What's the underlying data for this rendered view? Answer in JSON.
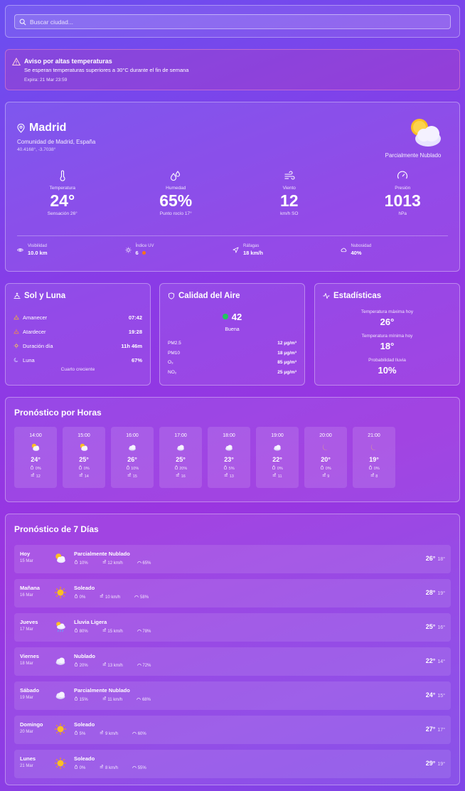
{
  "search": {
    "placeholder": "Buscar ciudad..."
  },
  "alert": {
    "title": "Aviso por altas temperaturas",
    "message": "Se esperan temperaturas superiores a 30°C durante el fin de semana",
    "expires": "Expira: 21 Mar 23:59"
  },
  "current": {
    "city": "Madrid",
    "region": "Comunidad de Madrid, España",
    "coords": "40.4168°, -3.7038°",
    "condition": "Parcialmente Nublado",
    "icon": "partly-cloudy-icon",
    "metrics": [
      {
        "label": "Temperatura",
        "value": "24°",
        "sub": "Sensación 26°",
        "icon": "thermometer-icon"
      },
      {
        "label": "Humedad",
        "value": "65%",
        "sub": "Punto rocío 17°",
        "icon": "droplets-icon"
      },
      {
        "label": "Viento",
        "value": "12",
        "sub": "km/h SO",
        "icon": "wind-icon"
      },
      {
        "label": "Presión",
        "value": "1013",
        "sub": "hPa",
        "icon": "gauge-icon"
      }
    ],
    "extras": [
      {
        "label": "Visibilidad",
        "value": "10.0 km",
        "icon": "eye-icon"
      },
      {
        "label": "Índice UV",
        "value": "6",
        "icon": "sun-icon",
        "dot_color": "#f97316"
      },
      {
        "label": "Ráfagas",
        "value": "18 km/h",
        "icon": "navigation-icon"
      },
      {
        "label": "Nubosidad",
        "value": "40%",
        "icon": "cloud-icon"
      }
    ]
  },
  "sun_moon": {
    "title": "Sol y Luna",
    "rows": [
      {
        "label": "Amanecer",
        "value": "07:42",
        "icon": "sunrise-icon"
      },
      {
        "label": "Atardecer",
        "value": "19:28",
        "icon": "sunset-icon"
      },
      {
        "label": "Duración día",
        "value": "11h 46m",
        "icon": "sun-icon"
      },
      {
        "label": "Luna",
        "value": "67%",
        "icon": "moon-icon"
      }
    ],
    "moon_phase": "Cuarto creciente"
  },
  "air": {
    "title": "Calidad del Aire",
    "aqi": "42",
    "aqi_color": "#22c55e",
    "aqi_label": "Buena",
    "pollutants": [
      {
        "name": "PM2.5",
        "value": "12 μg/m³"
      },
      {
        "name": "PM10",
        "value": "18 μg/m³"
      },
      {
        "name": "O₃",
        "value": "85 μg/m³"
      },
      {
        "name": "NO₂",
        "value": "25 μg/m³"
      }
    ]
  },
  "stats": {
    "title": "Estadísticas",
    "items": [
      {
        "label": "Temperatura máxima hoy",
        "value": "26°"
      },
      {
        "label": "Temperatura mínima hoy",
        "value": "18°"
      },
      {
        "label": "Probabilidad lluvia",
        "value": "10%"
      }
    ]
  },
  "hourly": {
    "title": "Pronóstico por Horas",
    "hours": [
      {
        "time": "14:00",
        "icon": "partly-cloudy-icon",
        "temp": "24°",
        "rain": "0%",
        "wind": "12"
      },
      {
        "time": "15:00",
        "icon": "partly-cloudy-icon",
        "temp": "25°",
        "rain": "0%",
        "wind": "14"
      },
      {
        "time": "16:00",
        "icon": "cloudy-icon",
        "temp": "26°",
        "rain": "10%",
        "wind": "15"
      },
      {
        "time": "17:00",
        "icon": "cloudy-icon",
        "temp": "25°",
        "rain": "20%",
        "wind": "16"
      },
      {
        "time": "18:00",
        "icon": "cloudy-icon",
        "temp": "23°",
        "rain": "5%",
        "wind": "13"
      },
      {
        "time": "19:00",
        "icon": "cloudy-icon",
        "temp": "22°",
        "rain": "0%",
        "wind": "11"
      },
      {
        "time": "20:00",
        "icon": "moon-icon",
        "temp": "20°",
        "rain": "0%",
        "wind": "9"
      },
      {
        "time": "21:00",
        "icon": "moon-icon",
        "temp": "19°",
        "rain": "0%",
        "wind": "8"
      }
    ]
  },
  "daily": {
    "title": "Pronóstico de 7 Días",
    "days": [
      {
        "name": "Hoy",
        "date": "15 Mar",
        "icon": "partly-cloudy-icon",
        "condition": "Parcialmente Nublado",
        "rain": "10%",
        "wind": "12 km/h",
        "humidity": "65%",
        "max": "26°",
        "min": "18°"
      },
      {
        "name": "Mañana",
        "date": "16 Mar",
        "icon": "sun-icon",
        "condition": "Soleado",
        "rain": "0%",
        "wind": "10 km/h",
        "humidity": "58%",
        "max": "28°",
        "min": "19°"
      },
      {
        "name": "Jueves",
        "date": "17 Mar",
        "icon": "rain-icon",
        "condition": "Lluvia Ligera",
        "rain": "80%",
        "wind": "15 km/h",
        "humidity": "78%",
        "max": "25°",
        "min": "16°"
      },
      {
        "name": "Viernes",
        "date": "18 Mar",
        "icon": "cloudy-icon",
        "condition": "Nublado",
        "rain": "20%",
        "wind": "13 km/h",
        "humidity": "72%",
        "max": "22°",
        "min": "14°"
      },
      {
        "name": "Sábado",
        "date": "19 Mar",
        "icon": "cloudy-icon",
        "condition": "Parcialmente Nublado",
        "rain": "15%",
        "wind": "11 km/h",
        "humidity": "68%",
        "max": "24°",
        "min": "15°"
      },
      {
        "name": "Domingo",
        "date": "20 Mar",
        "icon": "sun-icon",
        "condition": "Soleado",
        "rain": "5%",
        "wind": "9 km/h",
        "humidity": "60%",
        "max": "27°",
        "min": "17°"
      },
      {
        "name": "Lunes",
        "date": "21 Mar",
        "icon": "sun-icon",
        "condition": "Soleado",
        "rain": "0%",
        "wind": "8 km/h",
        "humidity": "55%",
        "max": "29°",
        "min": "19°"
      }
    ]
  }
}
